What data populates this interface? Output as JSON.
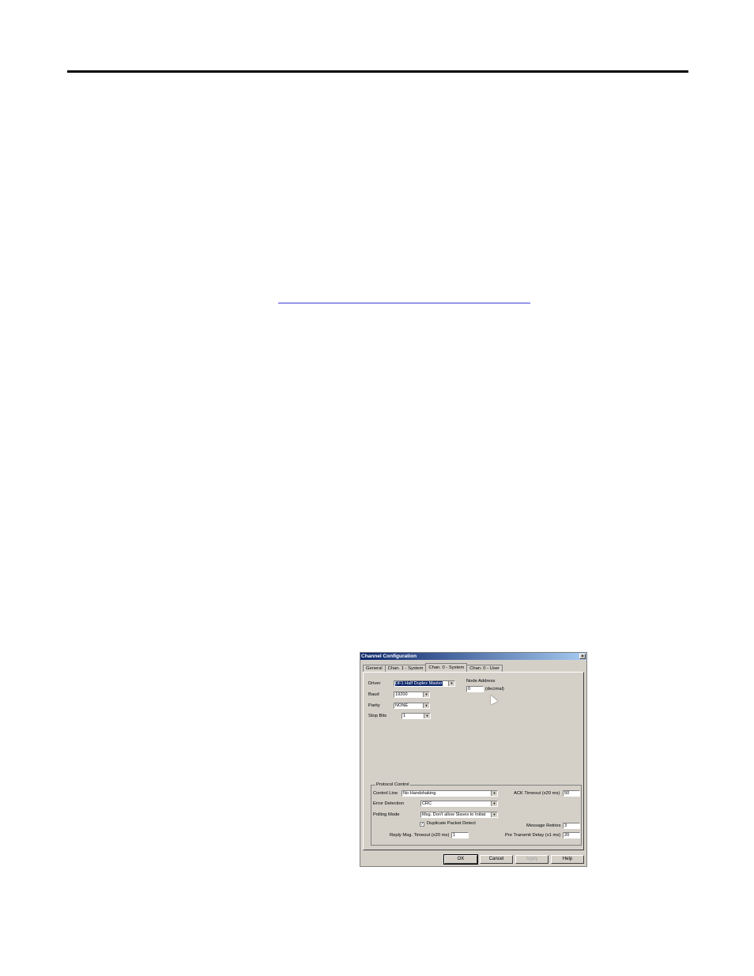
{
  "dialog": {
    "title": "Channel Configuration",
    "close_glyph": "×",
    "tabs": [
      {
        "label": "General"
      },
      {
        "label": "Chan. 1 - System"
      },
      {
        "label": "Chan. 0 - System"
      },
      {
        "label": "Chan. 0 - User"
      }
    ],
    "active_tab": "Chan. 0 - System",
    "driver": {
      "label": "Driver",
      "value": "DF1 Half Duplex Master"
    },
    "baud": {
      "label": "Baud",
      "value": "19200"
    },
    "parity": {
      "label": "Parity",
      "value": "NONE"
    },
    "stop_bits": {
      "label": "Stop Bits",
      "value": "1"
    },
    "node_address": {
      "label": "Node Address",
      "value": "0",
      "unit": "(decimal)"
    },
    "protocol_control": {
      "title": "Protocol Control",
      "control_line": {
        "label": "Control Line",
        "value": "No Handshaking"
      },
      "error_detection": {
        "label": "Error Detection",
        "value": "CRC"
      },
      "polling_mode": {
        "label": "Polling Mode",
        "value": "Msg. Don't allow Slaves to Initiat"
      },
      "duplicate_packet_detect": {
        "label": "Duplicate Packet Detect",
        "checked": true,
        "mark": "✓"
      },
      "reply_msg_timeout": {
        "label": "Reply Msg. Timeout (x20 ms)",
        "value": "1"
      },
      "ack_timeout": {
        "label": "ACK Timeout (x20 ms)",
        "value": "50"
      },
      "message_retries": {
        "label": "Message Retries",
        "value": "3"
      },
      "pre_transmit_delay": {
        "label": "Pre Transmit Delay (x1 ms)",
        "value": "20"
      }
    },
    "buttons": {
      "ok": "OK",
      "cancel": "Cancel",
      "apply": "Apply",
      "help": "Help"
    },
    "dropdown_glyph": "▼"
  }
}
